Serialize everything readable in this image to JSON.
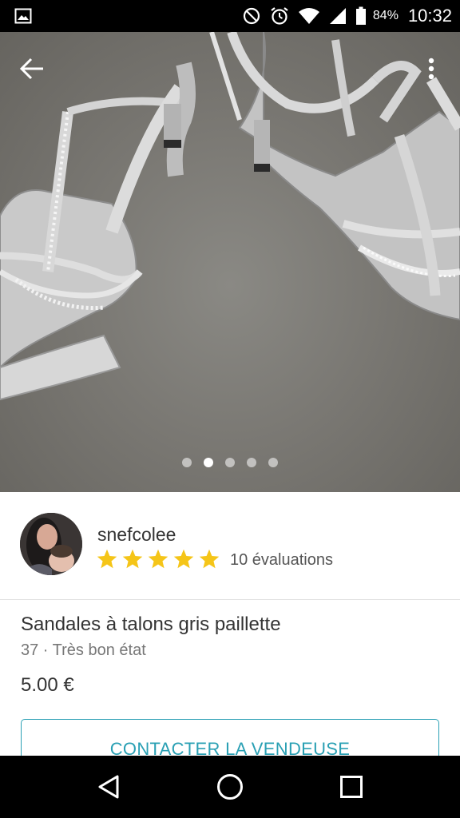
{
  "status_bar": {
    "battery": "84%",
    "time": "10:32"
  },
  "gallery": {
    "image_count": 5,
    "active_index": 1
  },
  "seller": {
    "username": "snefcolee",
    "rating_stars": 5,
    "reviews": "10 évaluations",
    "star_color": "#f5c518"
  },
  "item": {
    "title": "Sandales à talons gris paillette",
    "details": "37 · Très bon état",
    "price": "5.00 €"
  },
  "actions": {
    "contact_label": "CONTACTER LA VENDEUSE",
    "accent_color": "#2aa0b4"
  },
  "icons": {
    "back": "arrow-left-icon",
    "more": "more-vertical-icon",
    "nav_back": "triangle-back-icon",
    "nav_home": "circle-home-icon",
    "nav_recents": "square-recents-icon"
  }
}
